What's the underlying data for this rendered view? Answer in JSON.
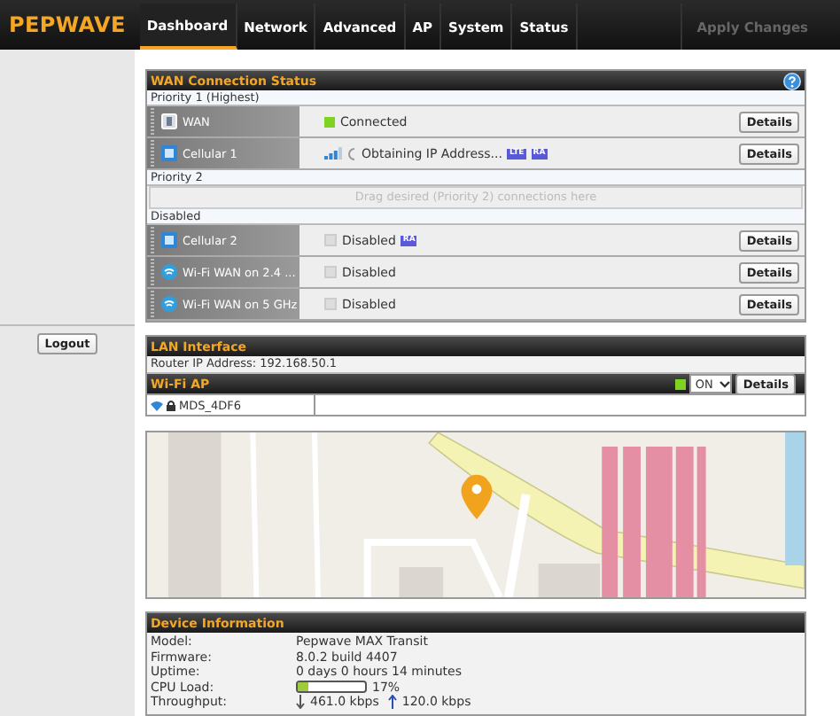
{
  "header": {
    "logo": "PEPWAVE",
    "tabs": [
      {
        "label": "Dashboard",
        "selected": true
      },
      {
        "label": "Network",
        "selected": false
      },
      {
        "label": "Advanced",
        "selected": false
      },
      {
        "label": "AP",
        "selected": false
      },
      {
        "label": "System",
        "selected": false
      },
      {
        "label": "Status",
        "selected": false
      }
    ],
    "apply": {
      "label": "Apply Changes",
      "disabled": true
    }
  },
  "sidebar": {
    "logout": "Logout"
  },
  "wan": {
    "title": "WAN Connection Status",
    "groups": [
      {
        "label": "Priority 1 (Highest)",
        "connections": [
          {
            "name": "WAN",
            "kind": "ethernet",
            "enabled": true,
            "signal": false,
            "status": "Connected",
            "button": "Details"
          },
          {
            "name": "Cellular 1",
            "kind": "cellular",
            "enabled": true,
            "signal": true,
            "status": "Obtaining IP Address...",
            "badges": [
              "LTE",
              "RA"
            ],
            "button": "Details"
          }
        ]
      },
      {
        "label": "Priority 2",
        "placeholder": "Drag desired (Priority 2) connections here"
      },
      {
        "label": "Disabled",
        "connections": [
          {
            "name": "Cellular 2",
            "kind": "cellular",
            "enabled": false,
            "signal": false,
            "status": "Disabled",
            "badges": [
              "RA"
            ],
            "button": "Details"
          },
          {
            "name": "Wi-Fi WAN on 2.4 ...",
            "kind": "wifi",
            "enabled": false,
            "signal": false,
            "status": "Disabled",
            "button": "Details"
          },
          {
            "name": "Wi-Fi WAN on 5 GHz",
            "kind": "wifi",
            "enabled": false,
            "signal": false,
            "status": "Disabled",
            "button": "Details"
          }
        ]
      }
    ]
  },
  "lan": {
    "title": "LAN Interface",
    "router_ip": "Router IP Address: 192.168.50.1"
  },
  "wifi_ap": {
    "title": "Wi-Fi AP",
    "on": true,
    "select": "ON",
    "button": "Details",
    "ssids": [
      "MDS_4DF6"
    ]
  },
  "device": {
    "title": "Device Information",
    "rows": [
      {
        "kind": "text",
        "label": "Model:",
        "value": "Pepwave MAX Transit"
      },
      {
        "kind": "text",
        "label": "Firmware:",
        "value": "8.0.2 build 4407"
      },
      {
        "kind": "text",
        "label": "Uptime:",
        "value": "0 days 0 hours 14 minutes"
      },
      {
        "kind": "meter",
        "label": "CPU Load:",
        "level": 0.17,
        "reading": "17%"
      },
      {
        "kind": "throughput",
        "label": "Throughput:",
        "down": "461.0 kbps",
        "up": "120.0 kbps"
      }
    ]
  }
}
